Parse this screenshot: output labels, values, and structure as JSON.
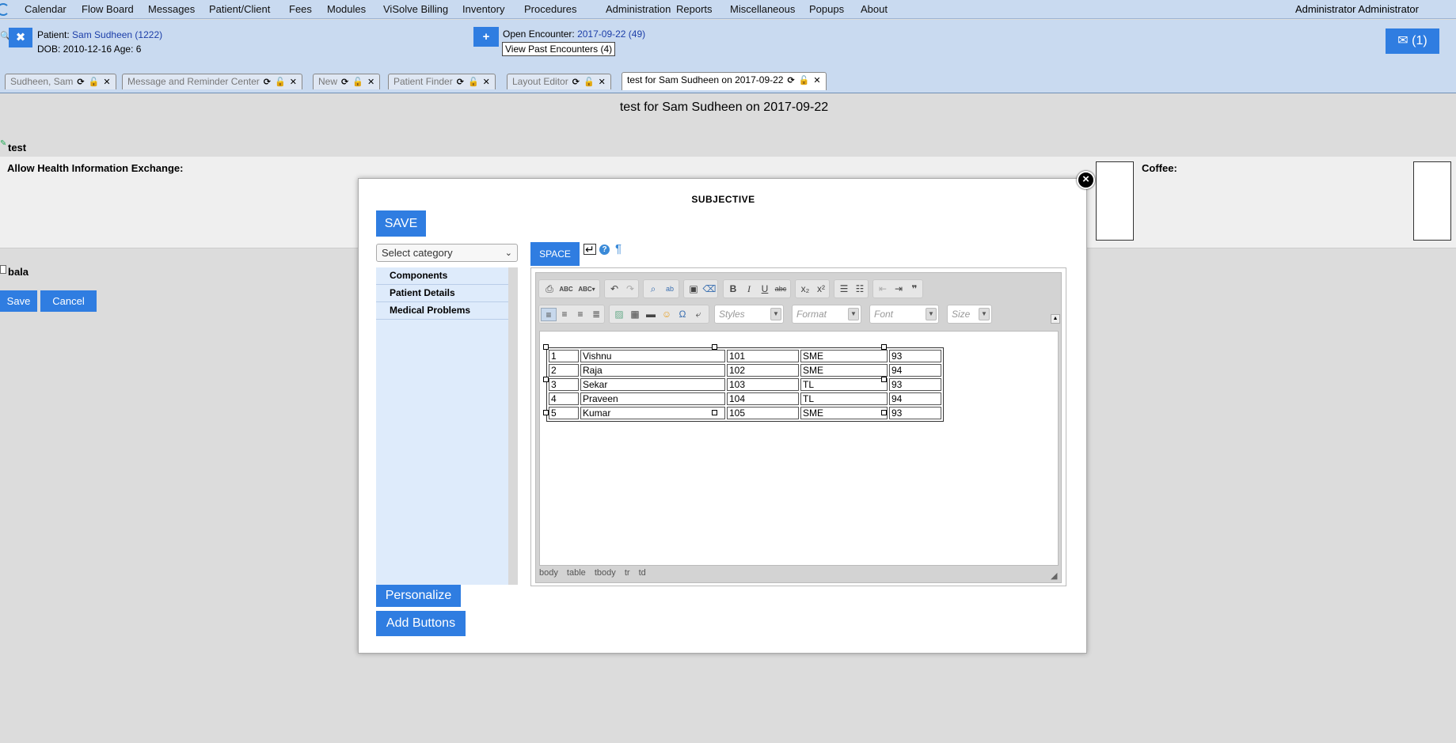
{
  "menu": {
    "items": [
      "Calendar",
      "Flow Board",
      "Messages",
      "Patient/Client",
      "Fees",
      "Modules",
      "ViSolve Billing",
      "Inventory",
      "Procedures",
      "Administration",
      "Reports",
      "Miscellaneous",
      "Popups",
      "About"
    ],
    "user": "Administrator Administrator"
  },
  "patient": {
    "label": "Patient:",
    "name": "Sam Sudheen (1222)",
    "dob_line": "DOB: 2010-12-16 Age: 6"
  },
  "encounter": {
    "label": "Open Encounter:",
    "value": "2017-09-22 (49)",
    "past": "View Past Encounters (4)"
  },
  "messages_button": "(1)",
  "tabs": [
    "Sudheen, Sam",
    "Message and Reminder Center",
    "New",
    "Patient Finder",
    "Layout Editor",
    "test for Sam Sudheen on 2017-09-22"
  ],
  "page": {
    "title": "test for Sam Sudheen on 2017-09-22",
    "section": "test",
    "hie_label": "Allow Health Information Exchange:",
    "coffee_label": "Coffee:",
    "bala_label": "bala",
    "save": "Save",
    "cancel": "Cancel"
  },
  "modal": {
    "title": "SUBJECTIVE",
    "save": "SAVE",
    "category_placeholder": "Select category",
    "categories": [
      "Components",
      "Patient Details",
      "Medical Problems"
    ],
    "space": "SPACE",
    "personalize": "Personalize",
    "add_buttons": "Add Buttons"
  },
  "editor": {
    "styles": "Styles",
    "format": "Format",
    "font": "Font",
    "size": "Size",
    "path": [
      "body",
      "table",
      "tbody",
      "tr",
      "td"
    ],
    "table": [
      [
        "1",
        "Vishnu",
        "101",
        "SME",
        "93"
      ],
      [
        "2",
        "Raja",
        "102",
        "SME",
        "94"
      ],
      [
        "3",
        "Sekar",
        "103",
        "TL",
        "93"
      ],
      [
        "4",
        "Praveen",
        "104",
        "TL",
        "94"
      ],
      [
        "5",
        "Kumar",
        "105",
        "SME",
        "93"
      ]
    ]
  },
  "colors": {
    "accent": "#2f7de1",
    "header_bg": "#c9daf0"
  }
}
